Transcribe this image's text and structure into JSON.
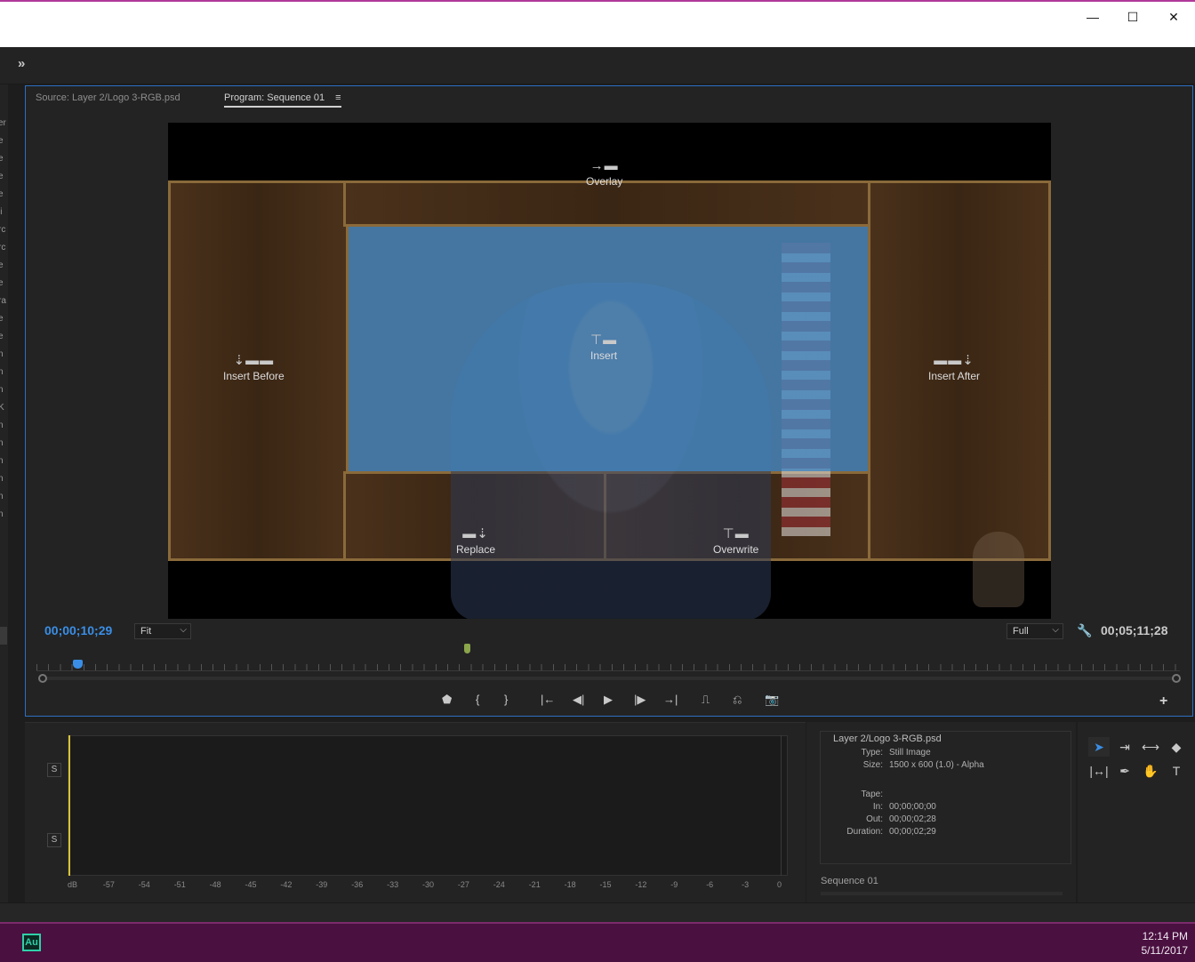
{
  "window": {
    "minimize_icon": "minimize-icon",
    "maximize_icon": "maximize-icon",
    "close_icon": "close-icon",
    "min_glyph": "—",
    "max_glyph": "☐",
    "close_glyph": "✕"
  },
  "toolbar": {
    "more_glyph": "»"
  },
  "left_strip": {
    "labels": [
      "er",
      "e",
      "e",
      "e",
      "e",
      "li",
      "rc",
      "rc",
      "e",
      "e",
      "ra",
      "e",
      "e",
      "n",
      "n",
      "n",
      "K",
      "n",
      "n",
      "n",
      "n",
      "n",
      "n"
    ]
  },
  "monitor": {
    "tabs": [
      {
        "label": "Source: Layer 2/Logo 3-RGB.psd",
        "active": false
      },
      {
        "label": "Program: Sequence 01",
        "active": true,
        "menu_glyph": "≡"
      }
    ],
    "drop_zones": {
      "overlay": {
        "label": "Overlay",
        "icon": "→▬"
      },
      "insert": {
        "label": "Insert",
        "icon": "⊤▬"
      },
      "insert_before": {
        "label": "Insert Before",
        "icon": "⇣▬▬"
      },
      "insert_after": {
        "label": "Insert After",
        "icon": "▬▬⇣"
      },
      "replace": {
        "label": "Replace",
        "icon": "▬⇣"
      },
      "overwrite": {
        "label": "Overwrite",
        "icon": "⊤▬"
      }
    },
    "timecode_current": "00;00;10;29",
    "zoom": {
      "selected": "Fit",
      "chevron": "⌵"
    },
    "resolution": {
      "selected": "Full",
      "chevron": "⌵"
    },
    "settings_glyph": "🔧",
    "timecode_duration": "00;05;11;28",
    "transport": {
      "add_marker": "⬟",
      "mark_in": "{",
      "mark_out": "}",
      "go_to_in": "|←",
      "step_back": "◀|",
      "play": "▶",
      "step_forward": "|▶",
      "go_to_out": "→|",
      "lift": "⎍",
      "extract": "⎌",
      "export_frame": "📷",
      "add_button": "+"
    }
  },
  "audio_meter": {
    "solo_label": "S",
    "scale": [
      "dB",
      "-57",
      "-54",
      "-51",
      "-48",
      "-45",
      "-42",
      "-39",
      "-36",
      "-33",
      "-30",
      "-27",
      "-24",
      "-21",
      "-18",
      "-15",
      "-12",
      "-9",
      "-6",
      "-3",
      "0"
    ]
  },
  "info": {
    "title": "Layer 2/Logo 3-RGB.psd",
    "type_label": "Type:",
    "type_value": "Still Image",
    "size_label": "Size:",
    "size_value": "1500 x 600 (1.0) - Alpha",
    "tape_label": "Tape:",
    "tape_value": "",
    "in_label": "In:",
    "in_value": "00;00;00;00",
    "out_label": "Out:",
    "out_value": "00;00;02;28",
    "duration_label": "Duration:",
    "duration_value": "00;00;02;29",
    "sequence": "Sequence 01"
  },
  "tools": [
    {
      "name": "selection-tool-icon",
      "glyph": "➤",
      "active": true
    },
    {
      "name": "track-select-tool-icon",
      "glyph": "⇥",
      "active": false
    },
    {
      "name": "ripple-edit-tool-icon",
      "glyph": "⟷",
      "active": false
    },
    {
      "name": "razor-tool-icon",
      "glyph": "◆",
      "active": false
    },
    {
      "name": "slip-tool-icon",
      "glyph": "|↔|",
      "active": false
    },
    {
      "name": "pen-tool-icon",
      "glyph": "✒",
      "active": false
    },
    {
      "name": "hand-tool-icon",
      "glyph": "✋",
      "active": false
    },
    {
      "name": "type-tool-icon",
      "glyph": "T",
      "active": false
    }
  ],
  "taskbar": {
    "app_icon_label": "Au",
    "time": "12:14 PM",
    "date": "5/11/2017"
  },
  "colors": {
    "accent": "#3a8ee6",
    "taskbar": "#4a1040",
    "audition": "#2fd0a8"
  }
}
